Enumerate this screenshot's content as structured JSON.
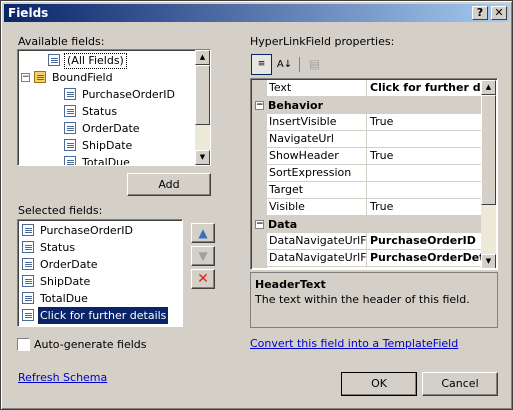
{
  "window": {
    "title": "Fields",
    "help_btn": "?",
    "close_btn": "✕"
  },
  "available": {
    "label": "Available fields:",
    "items": [
      "(All Fields)",
      "BoundField",
      "PurchaseOrderID",
      "Status",
      "OrderDate",
      "ShipDate",
      "TotalDue"
    ]
  },
  "add_button": "Add",
  "selected": {
    "label": "Selected fields:",
    "items": [
      "PurchaseOrderID",
      "Status",
      "OrderDate",
      "ShipDate",
      "TotalDue",
      "Click for further details"
    ]
  },
  "autogen_label": "Auto-generate fields",
  "refresh_link": "Refresh Schema",
  "props": {
    "label": "HyperLinkField properties:",
    "rows": [
      {
        "name": "Text",
        "value": "Click for further deta"
      },
      {
        "category": "Behavior"
      },
      {
        "name": "InsertVisible",
        "value": "True"
      },
      {
        "name": "NavigateUrl",
        "value": ""
      },
      {
        "name": "ShowHeader",
        "value": "True"
      },
      {
        "name": "SortExpression",
        "value": ""
      },
      {
        "name": "Target",
        "value": ""
      },
      {
        "name": "Visible",
        "value": "True"
      },
      {
        "category": "Data"
      },
      {
        "name": "DataNavigateUrlFiel",
        "value": "PurchaseOrderID"
      },
      {
        "name": "DataNavigateUrlForr",
        "value": "PurchaseOrderDeta"
      }
    ],
    "desc_title": "HeaderText",
    "desc_text": "The text within the header of this field."
  },
  "convert_link": "Convert this field into a TemplateField",
  "ok_button": "OK",
  "cancel_button": "Cancel",
  "colors": {
    "selection": "#0a246a",
    "link": "#0000cc"
  }
}
